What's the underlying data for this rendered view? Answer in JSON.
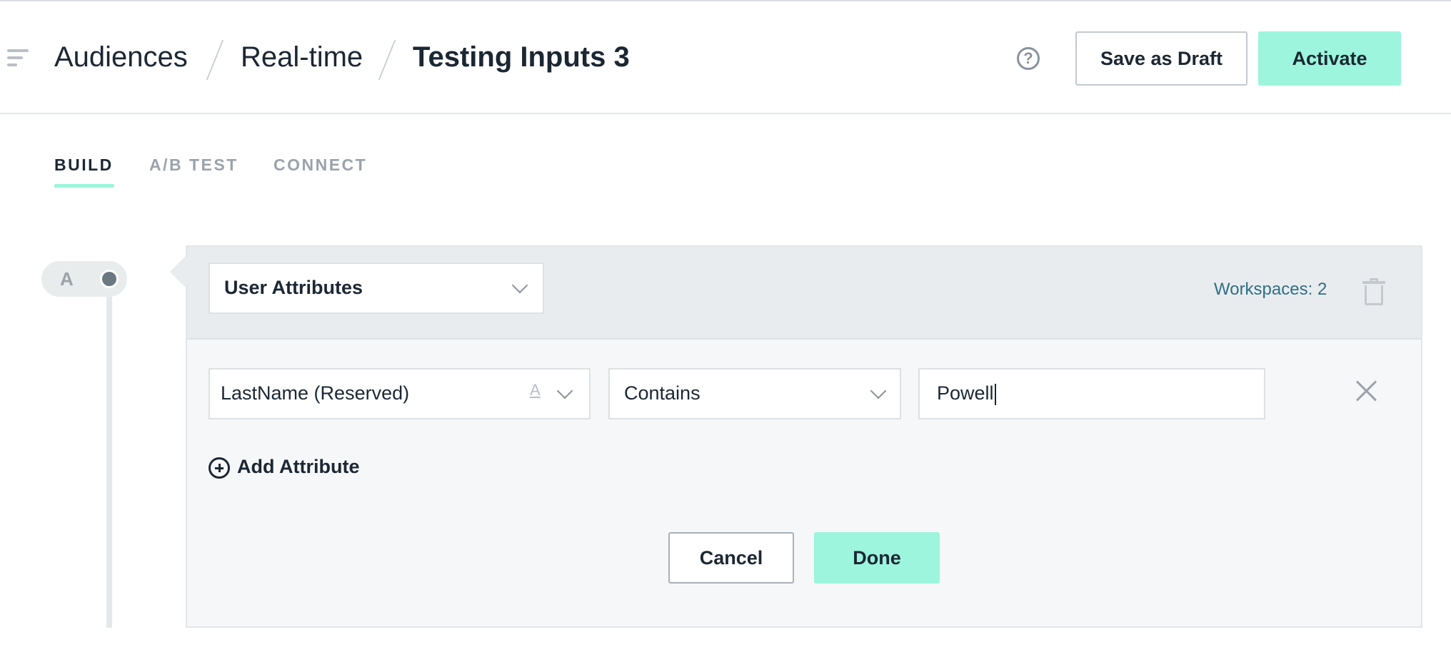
{
  "breadcrumb": {
    "items": [
      "Audiences",
      "Real-time",
      "Testing Inputs 3"
    ]
  },
  "header": {
    "help_glyph": "?",
    "save_draft_label": "Save as Draft",
    "activate_label": "Activate"
  },
  "tabs": [
    {
      "label": "BUILD",
      "active": true
    },
    {
      "label": "A/B TEST",
      "active": false
    },
    {
      "label": "CONNECT",
      "active": false
    }
  ],
  "rail": {
    "letter": "A"
  },
  "condition": {
    "type_select": "User Attributes",
    "workspaces_label": "Workspaces: 2",
    "attribute_select": "LastName (Reserved)",
    "attribute_type_glyph": "A",
    "operator_select": "Contains",
    "value_input": "Powell",
    "add_attribute_label": "Add Attribute",
    "cancel_label": "Cancel",
    "done_label": "Done"
  },
  "colors": {
    "accent": "#9cf5dc",
    "text_primary": "#1b2733",
    "text_muted": "#9aa2ab",
    "link_teal": "#2f6f85"
  }
}
